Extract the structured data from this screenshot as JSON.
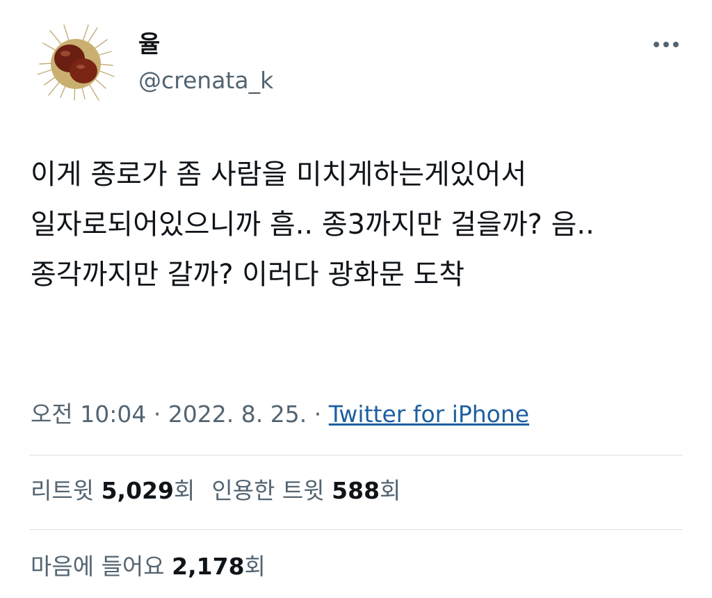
{
  "author": {
    "display_name": "율",
    "handle": "@crenata_k",
    "avatar_icon": "chestnut-avatar"
  },
  "more_icon": "more-dots-icon",
  "tweet": {
    "text": "이게 종로가 좀 사람을 미치게하는게있어서 일자로되어있으니까 흠.. 종3까지만 걸을까? 음.. 종각까지만 갈까? 이러다 광화문 도착"
  },
  "meta": {
    "time": "오전 10:04",
    "separator": "·",
    "date": "2022. 8. 25.",
    "source": "Twitter for iPhone"
  },
  "stats": {
    "retweets_label": "리트윗",
    "retweets_count": "5,029",
    "retweets_unit": "회",
    "quotes_label": "인용한 트윗",
    "quotes_count": "588",
    "quotes_unit": "회",
    "likes_label": "마음에 들어요",
    "likes_count": "2,178",
    "likes_unit": "회"
  },
  "colors": {
    "text_primary": "#0f1419",
    "text_secondary": "#536471",
    "link": "#1d5f9f",
    "divider": "#dcdfe2"
  }
}
